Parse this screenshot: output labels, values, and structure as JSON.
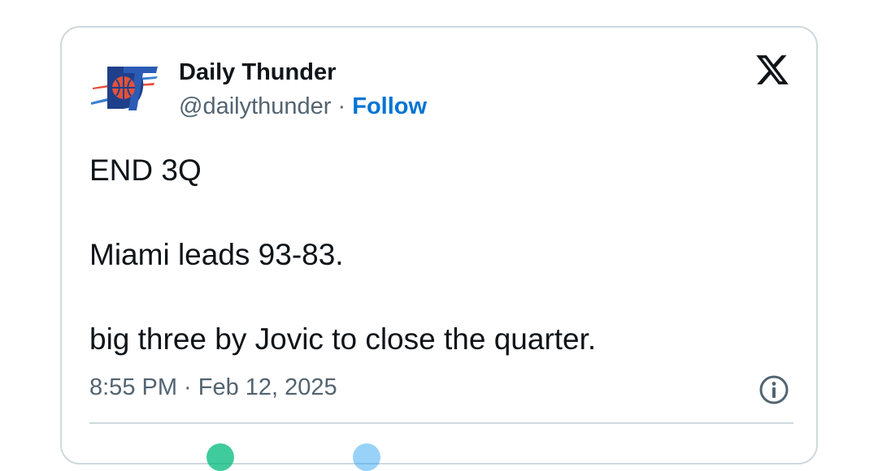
{
  "author": {
    "name": "Daily Thunder",
    "handle": "@dailythunder",
    "separator": " · ",
    "follow_label": "Follow",
    "avatar_icon": "daily-thunder-logo"
  },
  "platform_icon": "x-logo-icon",
  "tweet": {
    "lines": [
      "END 3Q",
      "Miami leads 93-83.",
      "big three by Jovic to close the quarter."
    ],
    "timestamp": "8:55 PM · Feb 12, 2025"
  },
  "info_icon": "info-icon",
  "colors": {
    "text": "#0f1419",
    "muted": "#536471",
    "link": "#0074d4",
    "border": "#cfd9de",
    "reply_accent": "#00ba7c",
    "like_accent": "#f91880"
  }
}
